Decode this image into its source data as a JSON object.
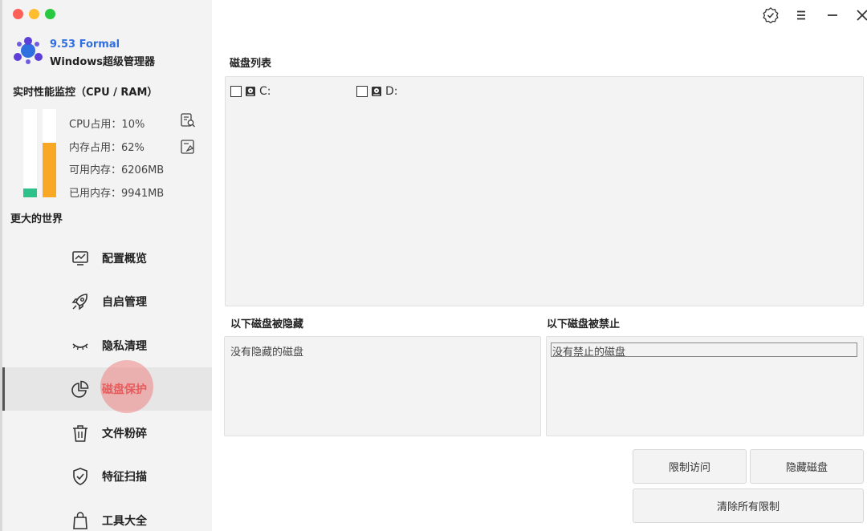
{
  "brand": {
    "version": "9.53 Formal",
    "name": "Windows超级管理器",
    "logo_icon": "molecule-logo-icon",
    "accent": "#2f6fe0"
  },
  "monitor": {
    "title": "实时性能监控（CPU / RAM）",
    "cpu_percent": 10,
    "mem_percent": 62,
    "stats": [
      "CPU占用：10%",
      "内存占用：62%",
      "可用内存：6206MB",
      "已用内存：9941MB"
    ],
    "cpu_color": "#2cc28a",
    "mem_color": "#f9a825"
  },
  "section": {
    "title": "更大的世界"
  },
  "nav": {
    "items": [
      {
        "label": "配置概览",
        "icon": "chart-monitor-icon"
      },
      {
        "label": "自启管理",
        "icon": "rocket-icon"
      },
      {
        "label": "隐私清理",
        "icon": "closed-eye-icon"
      },
      {
        "label": "磁盘保护",
        "icon": "pie-chart-icon",
        "active": true
      },
      {
        "label": "文件粉碎",
        "icon": "trash-icon"
      },
      {
        "label": "特征扫描",
        "icon": "shield-check-icon"
      },
      {
        "label": "工具大全",
        "icon": "shopping-bag-icon"
      }
    ]
  },
  "header": {
    "icons": [
      "verified-badge-icon",
      "menu-icon",
      "minimize-icon",
      "close-icon"
    ]
  },
  "disk_list": {
    "title": "磁盘列表",
    "disks": [
      {
        "label": "C:",
        "checked": false
      },
      {
        "label": "D:",
        "checked": false
      }
    ]
  },
  "hidden": {
    "title": "以下磁盘被隐藏",
    "empty": "没有隐藏的磁盘"
  },
  "blocked": {
    "title": "以下磁盘被禁止",
    "empty": "没有禁止的磁盘"
  },
  "buttons": {
    "restrict": "限制访问",
    "hide": "隐藏磁盘",
    "clear": "清除所有限制"
  }
}
